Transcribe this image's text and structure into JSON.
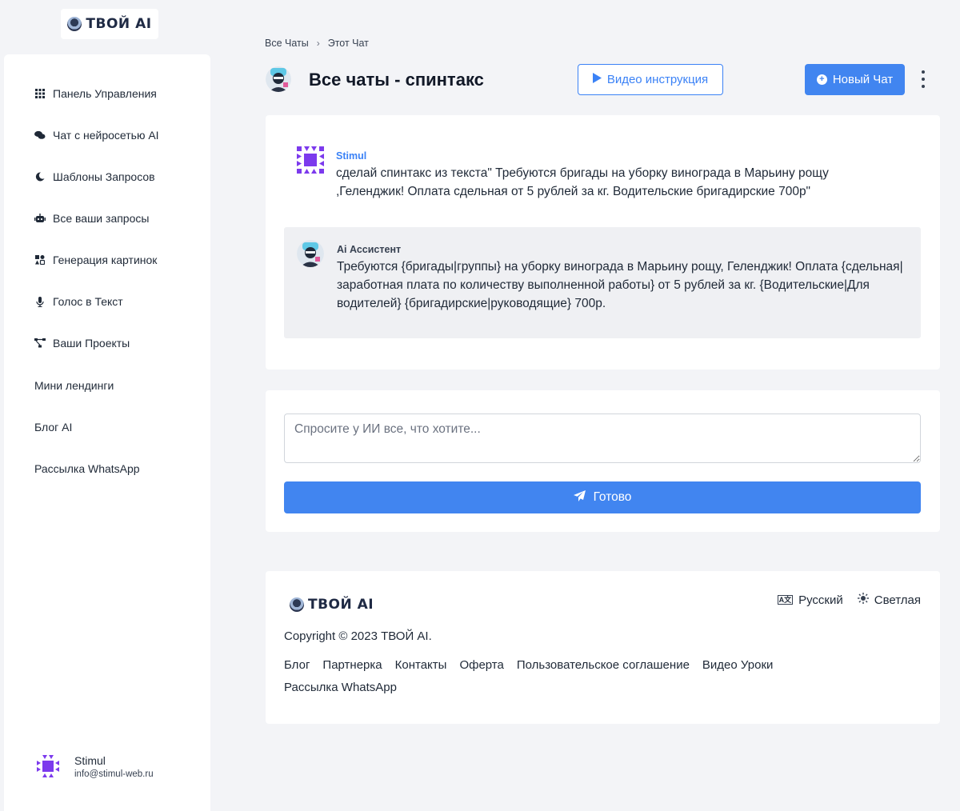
{
  "brand": {
    "logo_text": "ТВОЙ AI"
  },
  "sidebar": {
    "items": [
      {
        "label": "Панель Управления",
        "icon": "grid-icon"
      },
      {
        "label": "Чат с нейросетью AI",
        "icon": "comments-icon"
      },
      {
        "label": "Шаблоны Запросов",
        "icon": "moon-icon"
      },
      {
        "label": "Все ваши запросы",
        "icon": "robot-icon"
      },
      {
        "label": "Генерация картинок",
        "icon": "shapes-icon"
      },
      {
        "label": "Голос в Текст",
        "icon": "microphone-icon"
      },
      {
        "label": "Ваши Проекты",
        "icon": "project-diagram-icon"
      },
      {
        "label": "Мини лендинги"
      },
      {
        "label": "Блог AI"
      },
      {
        "label": "Рассылка WhatsApp"
      }
    ],
    "user": {
      "name": "Stimul",
      "email": "info@stimul-web.ru"
    }
  },
  "breadcrumb": {
    "parent": "Все Чаты",
    "current": "Этот Чат"
  },
  "header": {
    "title": "Все чаты - спинтакс",
    "video_button": "Видео инструкция",
    "new_chat_button": "Новый Чат"
  },
  "chat": {
    "messages": [
      {
        "author": "Stimul",
        "text": "сделай спинтакс из текста\" Требуются бригады на уборку винограда в Марьину рощу ,Геленджик! Оплата сдельная от 5 рублей за кг. Водительские бригадирские 700р\""
      },
      {
        "author": "Ai Ассистент",
        "text": "Требуются {бригады|группы} на уборку винограда в Марьину рощу, Геленджик! Оплата {сдельная|заработная плата по количеству выполненной работы} от 5 рублей за кг. {Водительские|Для водителей} {бригадирские|руководящие} 700р."
      }
    ]
  },
  "input": {
    "placeholder": "Спросите у ИИ все, что хотите...",
    "value": "",
    "submit_label": "Готово"
  },
  "footer": {
    "logo_text": "ТВОЙ AI",
    "language": "Русский",
    "theme": "Светлая",
    "copyright": "Copyright © 2023 ТВОЙ AI.",
    "links": [
      "Блог",
      "Партнерка",
      "Контакты",
      "Оферта",
      "Пользовательское соглашение",
      "Видео Уроки",
      "Рассылка WhatsApp"
    ]
  },
  "colors": {
    "accent": "#4185f0",
    "background": "#f3f4f7",
    "ai_bubble": "#eff0f3"
  }
}
